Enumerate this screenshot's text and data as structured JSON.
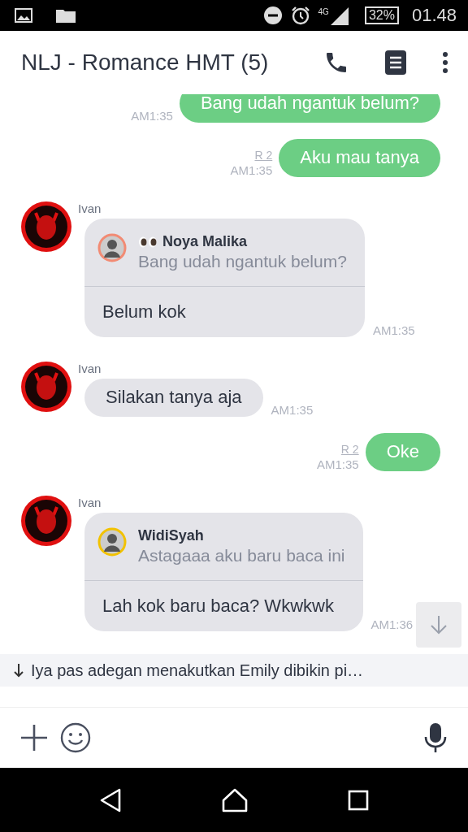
{
  "status_bar": {
    "network": "4G",
    "battery": "32%",
    "time": "01.48"
  },
  "header": {
    "title": "NLJ - Romance HMT (5)"
  },
  "messages": [
    {
      "kind": "sent",
      "text": "Bang udah ngantuk belum?",
      "time": "AM1:35"
    },
    {
      "kind": "sent",
      "text": "Aku mau tanya",
      "read": "R 2",
      "time": "AM1:35"
    },
    {
      "kind": "reply",
      "sender": "Ivan",
      "quote": {
        "name": "Noya Malika",
        "eyes": true,
        "text": "Bang udah ngantuk belum?",
        "color": "#f28b74"
      },
      "text": "Belum kok",
      "time": "AM1:35"
    },
    {
      "kind": "received",
      "sender": "Ivan",
      "text": "Silakan tanya aja",
      "time": "AM1:35"
    },
    {
      "kind": "sent",
      "text": "Oke",
      "read": "R 2",
      "time": "AM1:35"
    },
    {
      "kind": "reply",
      "sender": "Ivan",
      "quote": {
        "name": "WidiSyah",
        "eyes": false,
        "text": "Astagaaa aku baru baca ini",
        "color": "#f2c200"
      },
      "text": "Lah kok baru baca? Wkwkwk",
      "time": "AM1:36"
    }
  ],
  "new_message_banner": {
    "text": "Iya pas adegan menakutkan Emily dibikin pi…"
  }
}
